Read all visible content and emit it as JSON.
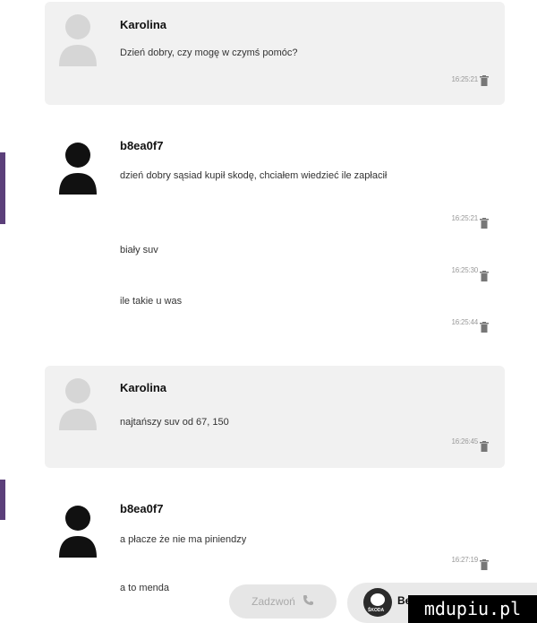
{
  "conversation": [
    {
      "author": "Karolina",
      "role": "agent",
      "lines": [
        {
          "text": "Dzień dobry, czy mogę w czymś pomóc?",
          "time": "16:25:21"
        }
      ]
    },
    {
      "author": "b8ea0f7",
      "role": "user",
      "lines": [
        {
          "text": "dzień dobry sąsiad kupił skodę, chciałem wiedzieć ile zapłacił",
          "time": "16:25:21"
        },
        {
          "text": "biały suv",
          "time": "16:25:30"
        },
        {
          "text": "ile takie u was",
          "time": "16:25:44"
        }
      ]
    },
    {
      "author": "Karolina",
      "role": "agent",
      "lines": [
        {
          "text": "najtańszy suv od 67, 150",
          "time": "16:26:45"
        }
      ]
    },
    {
      "author": "b8ea0f7",
      "role": "user",
      "lines": [
        {
          "text": "a płacze że nie ma piniendzy",
          "time": "16:27:19"
        }
      ]
    }
  ],
  "draft_text": "a to menda",
  "actions": {
    "call_label": "Zadzwoń",
    "brand_label": "Bez",
    "brand_logo_text": "ŠKODA"
  },
  "watermark": "mdupiu.pl",
  "icons": {
    "avatar": "person-silhouette-icon",
    "delete": "trash-icon",
    "call": "phone-icon",
    "brand": "skoda-logo"
  },
  "colors": {
    "agent_bubble": "#f1f1f1",
    "user_avatar": "#111111",
    "agent_avatar": "#d6d6d6",
    "accent_bar": "#6a4c8a"
  }
}
